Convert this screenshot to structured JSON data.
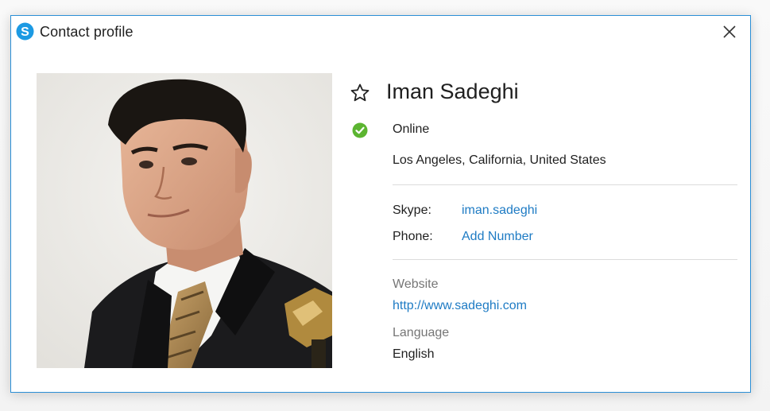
{
  "window": {
    "title": "Contact profile",
    "close_icon": "close-icon",
    "app_icon": "skype-logo-icon"
  },
  "profile": {
    "name": "Iman Sadeghi",
    "status": "Online",
    "location": "Los Angeles, California, United States",
    "favorite_icon": "star-outline-icon",
    "status_icon": "check-circle-icon"
  },
  "fields": {
    "skype_label": "Skype:",
    "skype_value": "iman.sadeghi",
    "phone_label": "Phone:",
    "phone_value": "Add Number"
  },
  "extra": {
    "website_label": "Website",
    "website_value": "http://www.sadeghi.com",
    "language_label": "Language",
    "language_value": "English"
  },
  "colors": {
    "accent": "#2b8fd6",
    "link": "#1e7bc4",
    "online": "#5cb531",
    "label_gray": "#767676"
  }
}
